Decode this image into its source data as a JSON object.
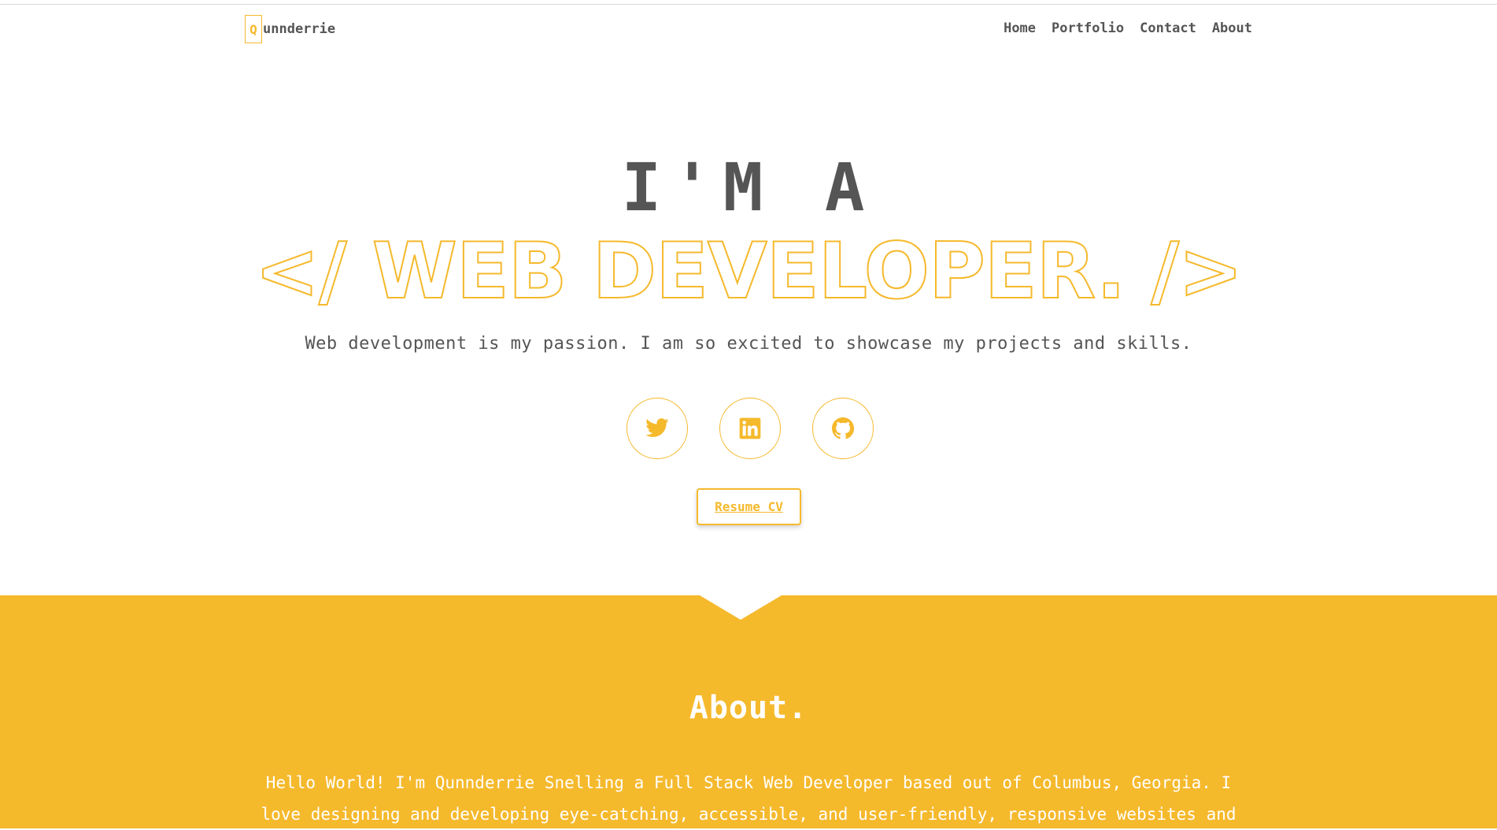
{
  "header": {
    "logo_letter": "Q",
    "logo_rest": "unnderrie",
    "nav": [
      {
        "label": "Home"
      },
      {
        "label": "Portfolio"
      },
      {
        "label": "Contact"
      },
      {
        "label": "About"
      }
    ]
  },
  "hero": {
    "intro": "I'M A",
    "role": "</ WEB DEVELOPER. />",
    "subtitle": "Web development is my passion. I am so excited to showcase my projects and skills.",
    "socials": [
      {
        "icon": "twitter-icon"
      },
      {
        "icon": "linkedin-icon"
      },
      {
        "icon": "github-icon"
      }
    ],
    "cv_button": "Resume CV"
  },
  "about": {
    "title": "About.",
    "text": "Hello World! I'm Qunnderrie Snelling a Full Stack Web Developer based out of Columbus, Georgia. I love designing and developing eye-catching, accessible, and user-friendly, responsive websites and"
  },
  "colors": {
    "accent": "#f5b92c",
    "text": "#555555",
    "background": "#ffffff"
  }
}
